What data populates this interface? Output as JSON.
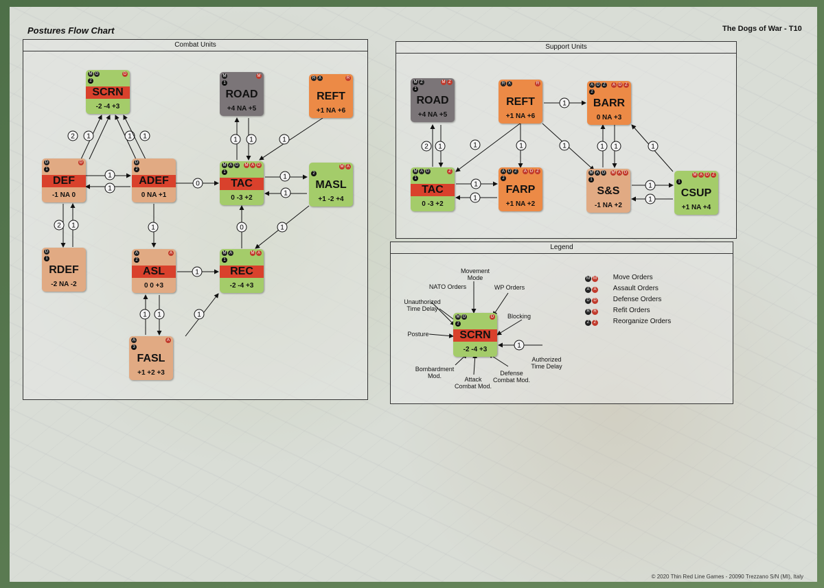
{
  "sheet": {
    "title": "Postures Flow Chart",
    "game": "The Dogs of War - T10",
    "footer": "© 2020 Thin Red Line Games - 20090 Trezzano S/N (MI), Italy"
  },
  "panels": {
    "combat": "Combat Units",
    "support": "Support Units",
    "legend": "Legend"
  },
  "counters": {
    "scrn": {
      "name": "SCRN",
      "vals": "-2  -4  +3",
      "tl": [
        "M",
        "O"
      ],
      "num": "2",
      "tr": [
        "D"
      ]
    },
    "road1": {
      "name": "ROAD",
      "vals": "+4  NA  +5",
      "tl": [
        "M"
      ],
      "num": "1",
      "tr": [
        "M"
      ]
    },
    "reft1": {
      "name": "REFT",
      "vals": "+1  NA  +6",
      "tl": [
        "R",
        "X"
      ],
      "tr": [
        "R"
      ]
    },
    "def": {
      "name": "DEF",
      "vals": "-1  NA  0",
      "tl": [
        "D"
      ],
      "num": "1",
      "tr": [
        "D"
      ]
    },
    "adef": {
      "name": "ADEF",
      "vals": "0  NA  +1",
      "tl": [
        "D"
      ],
      "num": "2",
      "tr": []
    },
    "tac1": {
      "name": "TAC",
      "vals": "0  -3  +2",
      "tl": [
        "M",
        "A",
        "D"
      ],
      "num": "1",
      "tr": [
        "M",
        "A",
        "D"
      ]
    },
    "masl": {
      "name": "MASL",
      "vals": "+1  -2  +4",
      "tl": [],
      "num": "2",
      "tr": [
        "M",
        "A"
      ]
    },
    "rdef": {
      "name": "RDEF",
      "vals": "-2  NA  -2",
      "tl": [
        "D"
      ],
      "num": "1",
      "tr": []
    },
    "asl": {
      "name": "ASL",
      "vals": "0  0  +3",
      "tl": [
        "A"
      ],
      "num": "2",
      "tr": [
        "A"
      ]
    },
    "rec": {
      "name": "REC",
      "vals": "-2  -4  +3",
      "tl": [
        "M",
        "A"
      ],
      "num": "1",
      "tr": [
        "M",
        "A"
      ]
    },
    "fasl": {
      "name": "FASL",
      "vals": "+1  +2  +3",
      "tl": [
        "A"
      ],
      "num": "3",
      "tr": [
        "A"
      ]
    },
    "road2": {
      "name": "ROAD",
      "vals": "+4  NA  +5",
      "tl": [
        "M",
        "Z"
      ],
      "num": "1",
      "tr": [
        "M",
        "Z"
      ]
    },
    "reft2": {
      "name": "REFT",
      "vals": "+1  NA  +6",
      "tl": [
        "R",
        "X"
      ],
      "tr": [
        "R"
      ]
    },
    "barr": {
      "name": "BARR",
      "vals": "0  NA  +3",
      "tl": [
        "A",
        "D",
        "Z"
      ],
      "num": "2",
      "tr": [
        "A",
        "D",
        "Z"
      ]
    },
    "tac2": {
      "name": "TAC",
      "vals": "0  -3  +2",
      "tl": [
        "M",
        "A",
        "D"
      ],
      "num": "1",
      "tr": [
        "Z"
      ]
    },
    "farp": {
      "name": "FARP",
      "vals": "+1  NA  +2",
      "tl": [
        "A",
        "D",
        "Z"
      ],
      "num": "2",
      "tr": [
        "A",
        "D",
        "Z"
      ]
    },
    "ss": {
      "name": "S&S",
      "vals": "-1  NA  +2",
      "tl": [
        "M",
        "A",
        "D"
      ],
      "num": "1",
      "tr": [
        "M",
        "A",
        "D"
      ]
    },
    "csup": {
      "name": "CSUP",
      "vals": "+1  NA  +4",
      "tl": [],
      "num": "1",
      "tr": [
        "M",
        "A",
        "D",
        "Z"
      ]
    },
    "scrn_legend": {
      "name": "SCRN",
      "vals": "-2  -4  +3",
      "tl": [
        "M",
        "O"
      ],
      "num": "2",
      "tr": [
        "D"
      ]
    }
  },
  "legend": {
    "items": [
      {
        "code": "M",
        "label": "Move Orders"
      },
      {
        "code": "A",
        "label": "Assault Orders"
      },
      {
        "code": "D",
        "label": "Defense Orders"
      },
      {
        "code": "R",
        "label": "Refit Orders"
      },
      {
        "code": "Z",
        "label": "Reorganize Orders"
      }
    ],
    "annotations": {
      "movement": "Movement\nMode",
      "nato": "NATO Orders",
      "wp": "WP Orders",
      "unauth": "Unauthorized\nTime Delay",
      "blocking": "Blocking",
      "posture": "Posture",
      "auth": "Authorized\nTime Delay",
      "bombard": "Bombardment\nMod.",
      "attack": "Attack\nCombat Mod.",
      "defense": "Defense\nCombat Mod."
    },
    "delay_value": "1"
  },
  "colors": {
    "green": "#a4cc6a",
    "peach": "#e1aa83",
    "orange": "#ec8a46",
    "gray": "#7b7578",
    "band": "#d9412c",
    "nato_badge": "#222222",
    "wp_badge": "#c0392b"
  },
  "edges": [
    {
      "label": "2"
    },
    {
      "label": "1"
    },
    {
      "label": "1"
    },
    {
      "label": "1"
    },
    {
      "label": "1"
    },
    {
      "label": "1"
    },
    {
      "label": "0"
    },
    {
      "label": "1"
    },
    {
      "label": "1"
    },
    {
      "label": "1"
    },
    {
      "label": "1"
    },
    {
      "label": "1"
    },
    {
      "label": "2"
    },
    {
      "label": "1"
    },
    {
      "label": "1"
    },
    {
      "label": "1"
    },
    {
      "label": "0"
    },
    {
      "label": "1"
    },
    {
      "label": "1"
    },
    {
      "label": "1"
    },
    {
      "label": "1"
    },
    {
      "label": "2"
    },
    {
      "label": "1"
    },
    {
      "label": "1"
    },
    {
      "label": "1"
    },
    {
      "label": "1"
    },
    {
      "label": "1"
    },
    {
      "label": "1"
    },
    {
      "label": "1"
    },
    {
      "label": "1"
    },
    {
      "label": "1"
    },
    {
      "label": "1"
    },
    {
      "label": "1"
    },
    {
      "label": "1"
    },
    {
      "label": "1"
    },
    {
      "label": "1"
    },
    {
      "label": "1"
    },
    {
      "label": "1"
    },
    {
      "label": "1"
    }
  ]
}
